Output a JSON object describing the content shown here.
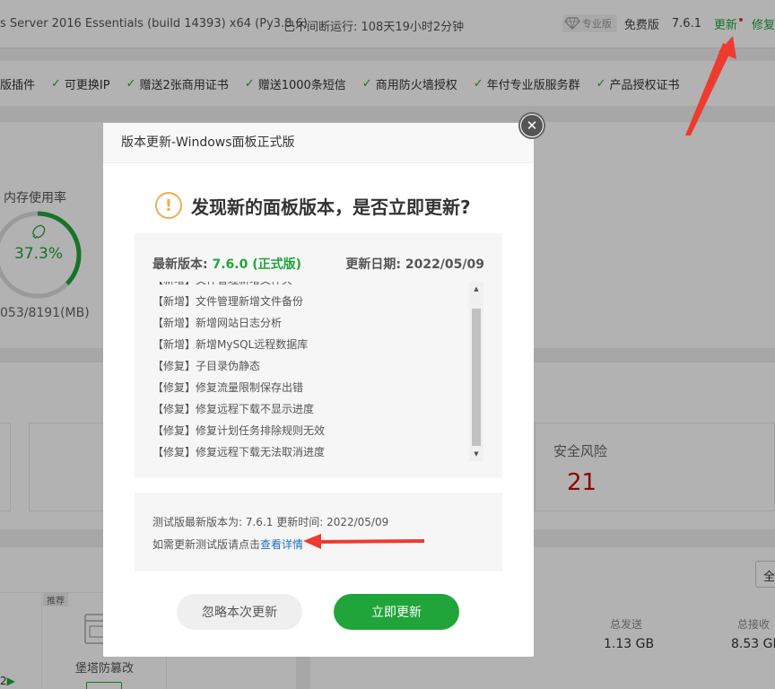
{
  "topbar": {
    "system_info": "s Server 2016 Essentials (build 14393) x64 (Py3.8.6)",
    "uptime": "已不间断运行: 108天19小时2分钟",
    "pro_badge": "专业版",
    "edition": "免费版",
    "version": "7.6.1",
    "update_link": "更新",
    "repair_link": "修复"
  },
  "features": [
    "版插件",
    "可更换IP",
    "赠送2张商用证书",
    "赠送1000条短信",
    "商用防火墙授权",
    "年付专业版服务群",
    "产品授权证书"
  ],
  "memory": {
    "label": "内存使用率",
    "percent_text": "37.3%",
    "percent": 37.3,
    "usage": "053/8191(MB)"
  },
  "security": {
    "label": "安全风险",
    "value": "21"
  },
  "bottom": {
    "recommend_tag": "推荐",
    "fortress_label": "堡塔防篡改",
    "total_sent_label": "总发送",
    "total_sent": "1.13 GB",
    "total_recv_label": "总接收",
    "total_recv": "8.53 GB",
    "select_all": "全",
    "left_num": "2"
  },
  "modal": {
    "title": "版本更新-Windows面板正式版",
    "headline": "发现新的面板版本，是否立即更新?",
    "latest_label": "最新版本:",
    "latest_version": "7.6.0 (正式版)",
    "update_date_label": "更新日期:",
    "update_date": "2022/05/09",
    "notes": [
      "【新增】文件管理新增文件夹",
      "【新增】文件管理新增文件备份",
      "【新增】新增网站日志分析",
      "【新增】新增MySQL远程数据库",
      "【修复】子目录伪静态",
      "【修复】修复流量限制保存出错",
      "【修复】修复远程下载不显示进度",
      "【修复】修复计划任务排除规则无效",
      "【修复】修复远程下载无法取消进度"
    ],
    "test_info": "测试版最新版本为:  7.6.1    更新时间: 2022/05/09",
    "test_prompt": "如需更新测试版请点击",
    "test_link": "查看详情",
    "ignore_button": "忽略本次更新",
    "update_button": "立即更新"
  },
  "colors": {
    "accent": "#20a53a",
    "danger": "#cc0000",
    "annotation": "#ee3b2f"
  }
}
